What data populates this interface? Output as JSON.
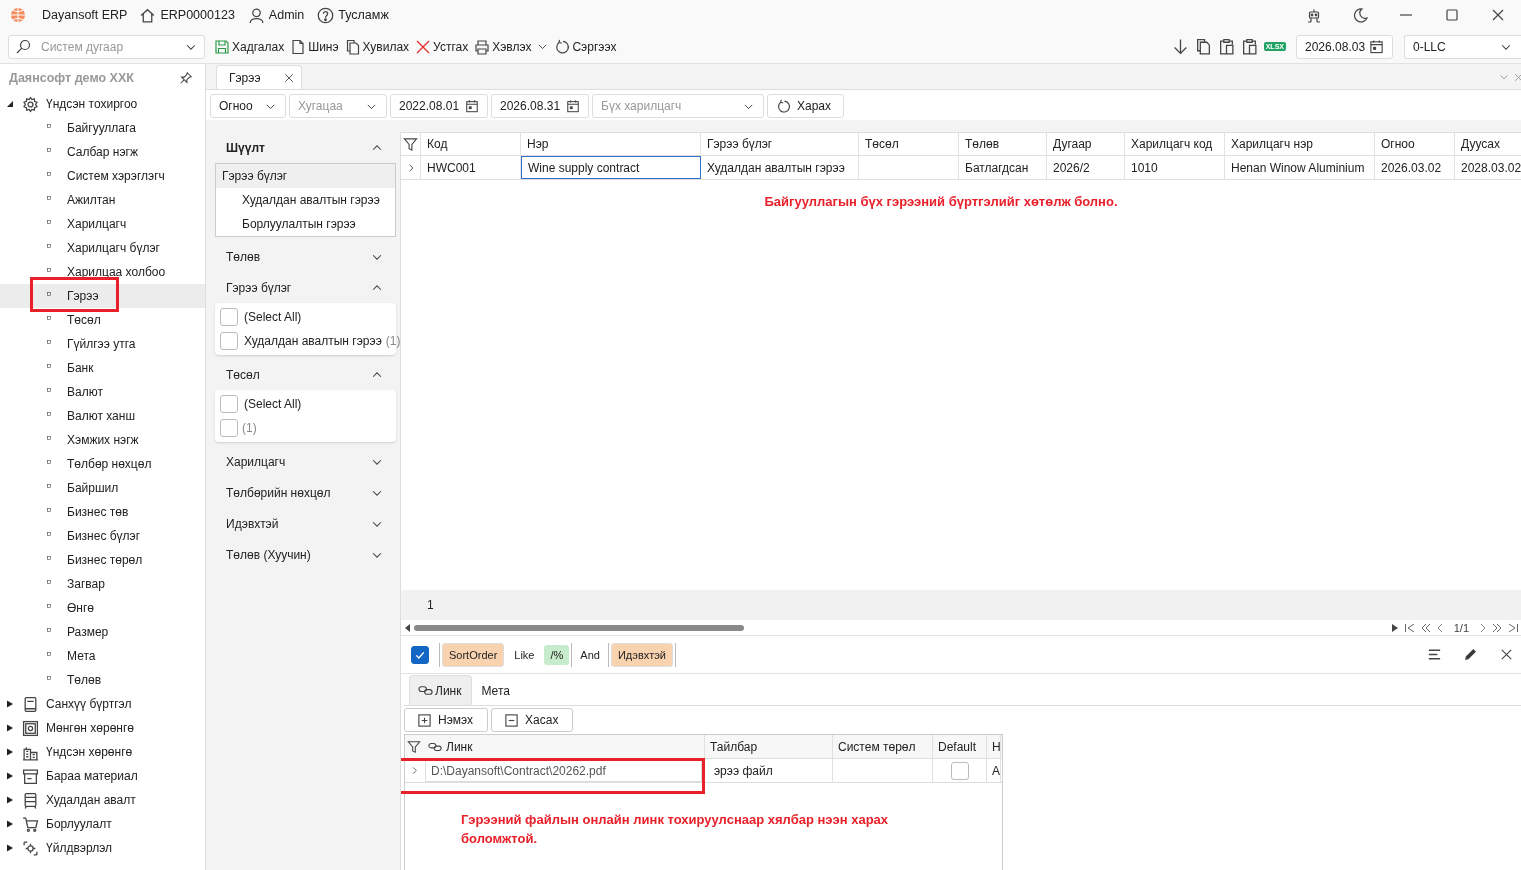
{
  "titlebar": {
    "app_name": "Dayansoft ERP",
    "items": [
      {
        "kind": "home",
        "label": "ERP0000123"
      },
      {
        "kind": "user",
        "label": "Admin"
      },
      {
        "kind": "help",
        "label": "Тусламж"
      }
    ]
  },
  "toolbar": {
    "search": {
      "placeholder": "Систем дугаар"
    },
    "actions": [
      {
        "kind": "save",
        "label": "Хадгалах"
      },
      {
        "kind": "new",
        "label": "Шинэ"
      },
      {
        "kind": "copy",
        "label": "Хувилах"
      },
      {
        "kind": "delete",
        "label": "Устгах"
      },
      {
        "kind": "print",
        "label": "Хэвлэх",
        "dropdown": true
      },
      {
        "kind": "refresh",
        "label": "Сэргээх"
      }
    ],
    "xlsx_label": "XLSX",
    "date": "2026.08.03",
    "company": "0-LLC"
  },
  "sidebar": {
    "title": "Даянсофт демо ХХК",
    "items": [
      {
        "label": "Үндсэн тохиргоо",
        "expanded": true,
        "children": [
          {
            "label": "Байгууллага",
            "selected": false,
            "highlighted": false
          },
          {
            "label": "Салбар нэгж",
            "selected": false,
            "highlighted": false
          },
          {
            "label": "Систем хэрэглэгч",
            "selected": false,
            "highlighted": false
          },
          {
            "label": "Ажилтан",
            "selected": false,
            "highlighted": false
          },
          {
            "label": "Харилцагч",
            "selected": false,
            "highlighted": false
          },
          {
            "label": "Харилцагч бүлэг",
            "selected": false,
            "highlighted": false
          },
          {
            "label": "Харилцаа холбоо",
            "selected": false,
            "highlighted": false
          },
          {
            "label": "Гэрээ",
            "selected": true,
            "highlighted": true
          },
          {
            "label": "Төсөл",
            "selected": false,
            "highlighted": false
          },
          {
            "label": "Гүйлгээ утга",
            "selected": false,
            "highlighted": false
          },
          {
            "label": "Банк",
            "selected": false,
            "highlighted": false
          },
          {
            "label": "Валют",
            "selected": false,
            "highlighted": false
          },
          {
            "label": "Валют ханш",
            "selected": false,
            "highlighted": false
          },
          {
            "label": "Хэмжих нэгж",
            "selected": false,
            "highlighted": false
          },
          {
            "label": "Төлбөр нөхцөл",
            "selected": false,
            "highlighted": false
          },
          {
            "label": "Байршил",
            "selected": false,
            "highlighted": false
          },
          {
            "label": "Бизнес төв",
            "selected": false,
            "highlighted": false
          },
          {
            "label": "Бизнес бүлэг",
            "selected": false,
            "highlighted": false
          },
          {
            "label": "Бизнес төрөл",
            "selected": false,
            "highlighted": false
          },
          {
            "label": "Загвар",
            "selected": false,
            "highlighted": false
          },
          {
            "label": "Өнгө",
            "selected": false,
            "highlighted": false
          },
          {
            "label": "Размер",
            "selected": false,
            "highlighted": false
          },
          {
            "label": "Мета",
            "selected": false,
            "highlighted": false
          },
          {
            "label": "Төлөв",
            "selected": false,
            "highlighted": false
          }
        ]
      },
      {
        "label": "Санхүү бүртгэл",
        "expanded": false
      },
      {
        "label": "Мөнгөн хөрөнгө",
        "expanded": false
      },
      {
        "label": "Үндсэн хөрөнгө",
        "expanded": false
      },
      {
        "label": "Бараа материал",
        "expanded": false
      },
      {
        "label": "Худалдан авалт",
        "expanded": false
      },
      {
        "label": "Борлуулалт",
        "expanded": false
      },
      {
        "label": "Үйлдвэрлэл",
        "expanded": false
      }
    ]
  },
  "tabs": [
    {
      "label": "Гэрээ",
      "selected": true
    }
  ],
  "filterbar": {
    "date_type": "Огноо",
    "period": {
      "placeholder": "Хугацаа"
    },
    "from": "2022.08.01",
    "to": "2026.08.31",
    "partner": {
      "placeholder": "Бүх харилцагч"
    },
    "view_button": "Харах"
  },
  "filter_panel": [
    {
      "title": "Шүүлт",
      "kind": "tree",
      "expanded": true,
      "group": "Гэрээ бүлэг",
      "items": [
        "Худалдан авалтын гэрээ",
        "Борлуулалтын гэрээ"
      ]
    },
    {
      "title": "Төлөв",
      "kind": "checklist",
      "expanded": false
    },
    {
      "title": "Гэрээ бүлэг",
      "kind": "checklist",
      "expanded": true,
      "options": [
        {
          "label": "(Select All)",
          "checked": false
        },
        {
          "label": "Худалдан авалтын гэрээ",
          "count": "(1)",
          "checked": false
        }
      ]
    },
    {
      "title": "Төсөл",
      "kind": "checklist",
      "expanded": true,
      "options": [
        {
          "label": "(Select All)",
          "checked": false
        },
        {
          "count": "(1)",
          "checked": false
        }
      ]
    },
    {
      "title": "Харилцагч",
      "kind": "checklist",
      "expanded": false
    },
    {
      "title": "Төлбөрийн нөхцөл",
      "kind": "checklist",
      "expanded": false
    },
    {
      "title": "Идэвхтэй",
      "kind": "checklist",
      "expanded": false
    },
    {
      "title": "Төлөв (Хуучин)",
      "kind": "checklist",
      "expanded": false
    }
  ],
  "grid": {
    "columns": [
      "Код",
      "Нэр",
      "Гэрээ бүлэг",
      "Төсөл",
      "Төлөв",
      "Дугаар",
      "Харилцагч код",
      "Харилцагч нэр",
      "Огноо",
      "Дуусах"
    ],
    "rows": [
      {
        "cells": [
          {
            "text": "HWC001",
            "focused": false
          },
          {
            "text": "Wine supply contract",
            "focused": true
          },
          {
            "text": "Худалдан авалтын гэрээ",
            "focused": false
          },
          {
            "focused": false
          },
          {
            "text": "Батлагдсан",
            "focused": false
          },
          {
            "text": "2026/2",
            "focused": false
          },
          {
            "text": "1010",
            "focused": false
          },
          {
            "text": "Henan Winow Aluminium",
            "focused": false
          },
          {
            "text": "2026.03.02",
            "focused": false
          },
          {
            "text": "2028.03.02",
            "focused": false
          }
        ]
      }
    ],
    "note": "Байгууллагын бүх гэрээний бүртгэлийг хөтөлж болно.",
    "row_count": "1",
    "pager": "1/1"
  },
  "filter_expression": {
    "enabled": true,
    "items": [
      {
        "kind": "group",
        "tokens": [
          {
            "kind": "field",
            "text": "SortOrder"
          },
          {
            "kind": "operator",
            "text": "Like"
          },
          {
            "kind": "value",
            "text": "/%"
          }
        ]
      },
      {
        "kind": "operator",
        "text": "And"
      },
      {
        "kind": "group",
        "tokens": [
          {
            "kind": "field",
            "text": "Идэвхтэй"
          }
        ]
      }
    ]
  },
  "detail": {
    "tabs": [
      {
        "label": "Линк",
        "selected": true
      },
      {
        "label": "Мета",
        "selected": false
      }
    ],
    "buttons": [
      {
        "kind": "add",
        "label": "Нэмэх"
      },
      {
        "kind": "remove",
        "label": "Хасах"
      }
    ],
    "grid": {
      "columns": [
        "Линк",
        "Тайлбар",
        "Систем төрөл",
        "Default",
        "Н"
      ],
      "rows": [
        {
          "highlighted": true,
          "link": "D:\\Dayansoft\\Contract\\20262.pdf",
          "description": "эрээ файл",
          "default": false,
          "column_5": "А"
        }
      ]
    },
    "note": "Гэрээний файлын онлайн линк тохируулснаар хялбар нээн харах боломжтой."
  }
}
